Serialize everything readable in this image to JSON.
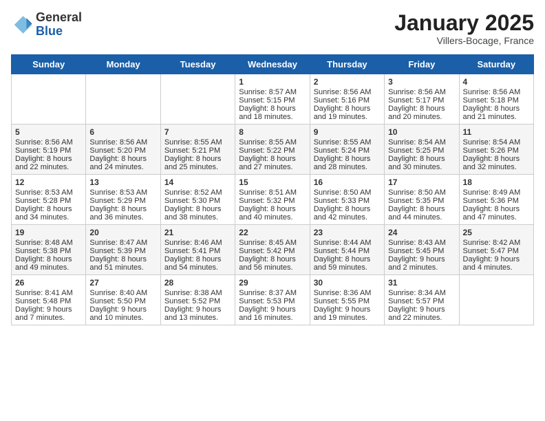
{
  "header": {
    "logo_general": "General",
    "logo_blue": "Blue",
    "month_title": "January 2025",
    "location": "Villers-Bocage, France"
  },
  "weekdays": [
    "Sunday",
    "Monday",
    "Tuesday",
    "Wednesday",
    "Thursday",
    "Friday",
    "Saturday"
  ],
  "weeks": [
    [
      {
        "day": "",
        "sunrise": "",
        "sunset": "",
        "daylight": ""
      },
      {
        "day": "",
        "sunrise": "",
        "sunset": "",
        "daylight": ""
      },
      {
        "day": "",
        "sunrise": "",
        "sunset": "",
        "daylight": ""
      },
      {
        "day": "1",
        "sunrise": "Sunrise: 8:57 AM",
        "sunset": "Sunset: 5:15 PM",
        "daylight": "Daylight: 8 hours and 18 minutes."
      },
      {
        "day": "2",
        "sunrise": "Sunrise: 8:56 AM",
        "sunset": "Sunset: 5:16 PM",
        "daylight": "Daylight: 8 hours and 19 minutes."
      },
      {
        "day": "3",
        "sunrise": "Sunrise: 8:56 AM",
        "sunset": "Sunset: 5:17 PM",
        "daylight": "Daylight: 8 hours and 20 minutes."
      },
      {
        "day": "4",
        "sunrise": "Sunrise: 8:56 AM",
        "sunset": "Sunset: 5:18 PM",
        "daylight": "Daylight: 8 hours and 21 minutes."
      }
    ],
    [
      {
        "day": "5",
        "sunrise": "Sunrise: 8:56 AM",
        "sunset": "Sunset: 5:19 PM",
        "daylight": "Daylight: 8 hours and 22 minutes."
      },
      {
        "day": "6",
        "sunrise": "Sunrise: 8:56 AM",
        "sunset": "Sunset: 5:20 PM",
        "daylight": "Daylight: 8 hours and 24 minutes."
      },
      {
        "day": "7",
        "sunrise": "Sunrise: 8:55 AM",
        "sunset": "Sunset: 5:21 PM",
        "daylight": "Daylight: 8 hours and 25 minutes."
      },
      {
        "day": "8",
        "sunrise": "Sunrise: 8:55 AM",
        "sunset": "Sunset: 5:22 PM",
        "daylight": "Daylight: 8 hours and 27 minutes."
      },
      {
        "day": "9",
        "sunrise": "Sunrise: 8:55 AM",
        "sunset": "Sunset: 5:24 PM",
        "daylight": "Daylight: 8 hours and 28 minutes."
      },
      {
        "day": "10",
        "sunrise": "Sunrise: 8:54 AM",
        "sunset": "Sunset: 5:25 PM",
        "daylight": "Daylight: 8 hours and 30 minutes."
      },
      {
        "day": "11",
        "sunrise": "Sunrise: 8:54 AM",
        "sunset": "Sunset: 5:26 PM",
        "daylight": "Daylight: 8 hours and 32 minutes."
      }
    ],
    [
      {
        "day": "12",
        "sunrise": "Sunrise: 8:53 AM",
        "sunset": "Sunset: 5:28 PM",
        "daylight": "Daylight: 8 hours and 34 minutes."
      },
      {
        "day": "13",
        "sunrise": "Sunrise: 8:53 AM",
        "sunset": "Sunset: 5:29 PM",
        "daylight": "Daylight: 8 hours and 36 minutes."
      },
      {
        "day": "14",
        "sunrise": "Sunrise: 8:52 AM",
        "sunset": "Sunset: 5:30 PM",
        "daylight": "Daylight: 8 hours and 38 minutes."
      },
      {
        "day": "15",
        "sunrise": "Sunrise: 8:51 AM",
        "sunset": "Sunset: 5:32 PM",
        "daylight": "Daylight: 8 hours and 40 minutes."
      },
      {
        "day": "16",
        "sunrise": "Sunrise: 8:50 AM",
        "sunset": "Sunset: 5:33 PM",
        "daylight": "Daylight: 8 hours and 42 minutes."
      },
      {
        "day": "17",
        "sunrise": "Sunrise: 8:50 AM",
        "sunset": "Sunset: 5:35 PM",
        "daylight": "Daylight: 8 hours and 44 minutes."
      },
      {
        "day": "18",
        "sunrise": "Sunrise: 8:49 AM",
        "sunset": "Sunset: 5:36 PM",
        "daylight": "Daylight: 8 hours and 47 minutes."
      }
    ],
    [
      {
        "day": "19",
        "sunrise": "Sunrise: 8:48 AM",
        "sunset": "Sunset: 5:38 PM",
        "daylight": "Daylight: 8 hours and 49 minutes."
      },
      {
        "day": "20",
        "sunrise": "Sunrise: 8:47 AM",
        "sunset": "Sunset: 5:39 PM",
        "daylight": "Daylight: 8 hours and 51 minutes."
      },
      {
        "day": "21",
        "sunrise": "Sunrise: 8:46 AM",
        "sunset": "Sunset: 5:41 PM",
        "daylight": "Daylight: 8 hours and 54 minutes."
      },
      {
        "day": "22",
        "sunrise": "Sunrise: 8:45 AM",
        "sunset": "Sunset: 5:42 PM",
        "daylight": "Daylight: 8 hours and 56 minutes."
      },
      {
        "day": "23",
        "sunrise": "Sunrise: 8:44 AM",
        "sunset": "Sunset: 5:44 PM",
        "daylight": "Daylight: 8 hours and 59 minutes."
      },
      {
        "day": "24",
        "sunrise": "Sunrise: 8:43 AM",
        "sunset": "Sunset: 5:45 PM",
        "daylight": "Daylight: 9 hours and 2 minutes."
      },
      {
        "day": "25",
        "sunrise": "Sunrise: 8:42 AM",
        "sunset": "Sunset: 5:47 PM",
        "daylight": "Daylight: 9 hours and 4 minutes."
      }
    ],
    [
      {
        "day": "26",
        "sunrise": "Sunrise: 8:41 AM",
        "sunset": "Sunset: 5:48 PM",
        "daylight": "Daylight: 9 hours and 7 minutes."
      },
      {
        "day": "27",
        "sunrise": "Sunrise: 8:40 AM",
        "sunset": "Sunset: 5:50 PM",
        "daylight": "Daylight: 9 hours and 10 minutes."
      },
      {
        "day": "28",
        "sunrise": "Sunrise: 8:38 AM",
        "sunset": "Sunset: 5:52 PM",
        "daylight": "Daylight: 9 hours and 13 minutes."
      },
      {
        "day": "29",
        "sunrise": "Sunrise: 8:37 AM",
        "sunset": "Sunset: 5:53 PM",
        "daylight": "Daylight: 9 hours and 16 minutes."
      },
      {
        "day": "30",
        "sunrise": "Sunrise: 8:36 AM",
        "sunset": "Sunset: 5:55 PM",
        "daylight": "Daylight: 9 hours and 19 minutes."
      },
      {
        "day": "31",
        "sunrise": "Sunrise: 8:34 AM",
        "sunset": "Sunset: 5:57 PM",
        "daylight": "Daylight: 9 hours and 22 minutes."
      },
      {
        "day": "",
        "sunrise": "",
        "sunset": "",
        "daylight": ""
      }
    ]
  ]
}
